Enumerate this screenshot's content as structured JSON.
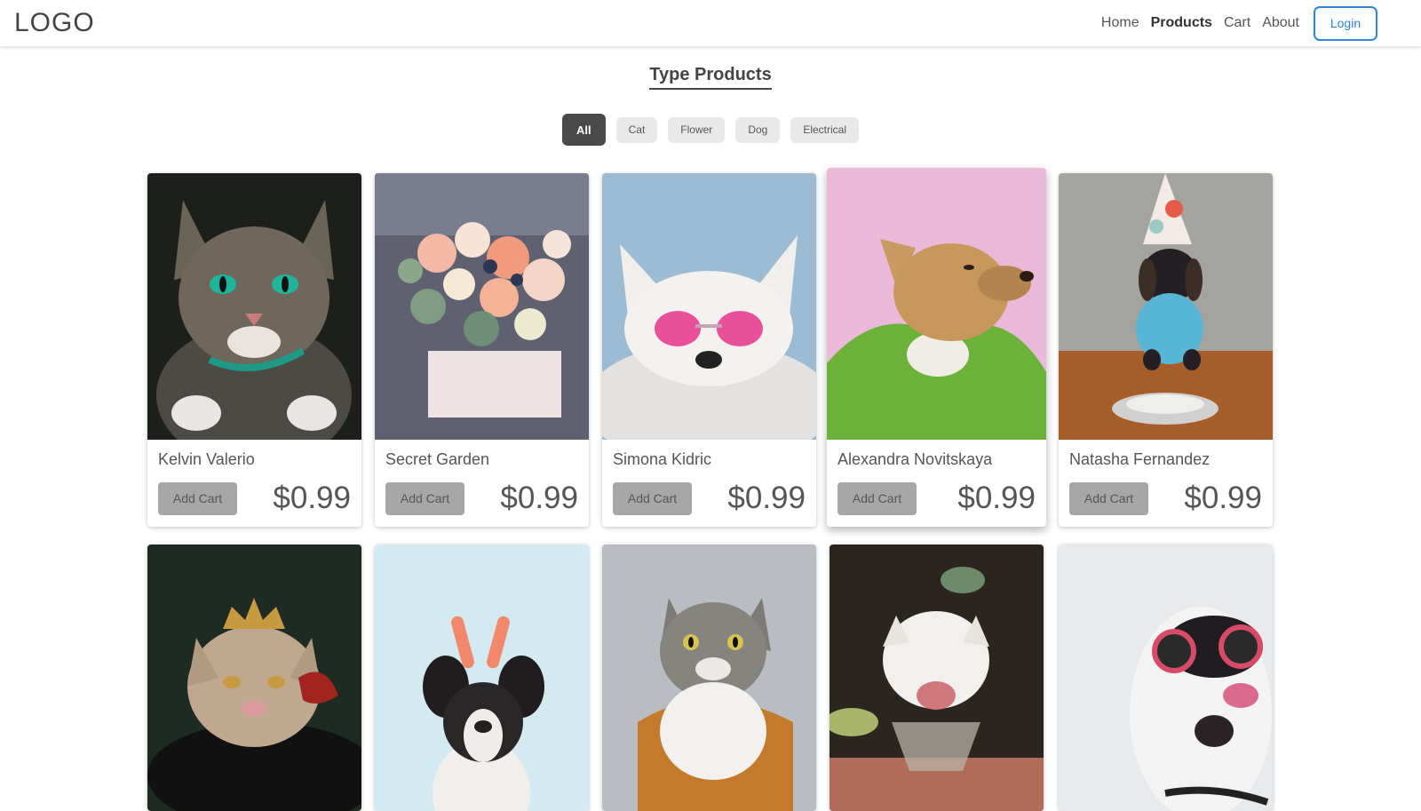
{
  "header": {
    "logo": "LOGO",
    "nav": [
      {
        "label": "Home",
        "active": false
      },
      {
        "label": "Products",
        "active": true
      },
      {
        "label": "Cart",
        "active": false
      },
      {
        "label": "About",
        "active": false
      }
    ],
    "login_label": "Login"
  },
  "main": {
    "title": "Type Products",
    "filters": [
      {
        "label": "All",
        "active": true
      },
      {
        "label": "Cat",
        "active": false
      },
      {
        "label": "Flower",
        "active": false
      },
      {
        "label": "Dog",
        "active": false
      },
      {
        "label": "Electrical",
        "active": false
      }
    ],
    "products": [
      {
        "name": "Kelvin Valerio",
        "price": "$0.99",
        "add_label": "Add Cart",
        "image": "cat-photo"
      },
      {
        "name": "Secret Garden",
        "price": "$0.99",
        "add_label": "Add Cart",
        "image": "flower-photo"
      },
      {
        "name": "Simona Kidric",
        "price": "$0.99",
        "add_label": "Add Cart",
        "image": "dog-photo"
      },
      {
        "name": "Alexandra Novitskaya",
        "price": "$0.99",
        "add_label": "Add Cart",
        "image": "dog-photo"
      },
      {
        "name": "Natasha Fernandez",
        "price": "$0.99",
        "add_label": "Add Cart",
        "image": "dog-photo"
      },
      {
        "image": "cat-photo"
      },
      {
        "image": "dog-photo"
      },
      {
        "image": "cat-photo"
      },
      {
        "image": "cat-photo"
      },
      {
        "image": "dog-photo"
      }
    ]
  },
  "colors": {
    "accent": "#2e86de",
    "active_filter": "#4a4a4a",
    "button_gray": "#a7a7a7"
  }
}
